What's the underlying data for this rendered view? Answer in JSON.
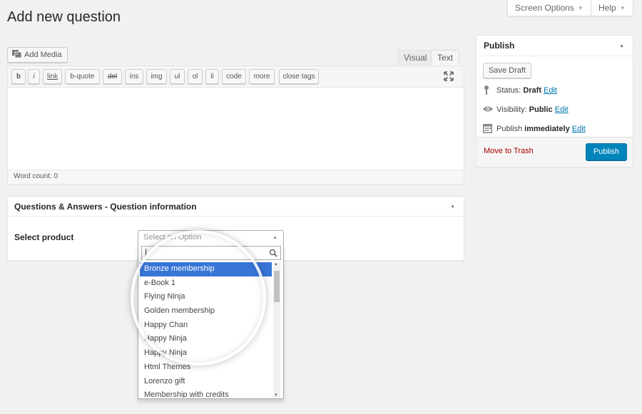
{
  "top_tabs": {
    "screen_options": "Screen Options",
    "help": "Help"
  },
  "page_title": "Add new question",
  "editor": {
    "add_media": "Add Media",
    "tabs": {
      "visual": "Visual",
      "text": "Text"
    },
    "toolbar": [
      "b",
      "i",
      "link",
      "b-quote",
      "del",
      "ins",
      "img",
      "ul",
      "ol",
      "li",
      "code",
      "more",
      "close tags"
    ],
    "word_count": "Word count: 0"
  },
  "metabox": {
    "title": "Questions & Answers - Question information",
    "field_label": "Select product",
    "select_placeholder": "Select an Option",
    "search_value": "",
    "options": [
      "Bronze membership",
      "e-Book 1",
      "Flying Ninja",
      "Golden membership",
      "Happy Chan",
      "Happy Ninja",
      "Happy Ninja",
      "Html Themes",
      "Lorenzo gift",
      "Membership with credits"
    ],
    "highlighted_index": 0
  },
  "publish": {
    "title": "Publish",
    "save_draft": "Save Draft",
    "status_label": "Status:",
    "status_value": "Draft",
    "visibility_label": "Visibility:",
    "visibility_value": "Public",
    "publish_label": "Publish",
    "publish_value": "immediately",
    "edit": "Edit",
    "move_to_trash": "Move to Trash",
    "publish_button": "Publish"
  },
  "colors": {
    "primary_button": "#0085ba",
    "link": "#0073aa",
    "trash": "#a00",
    "highlight": "#3875d7",
    "background": "#f1f1f1"
  },
  "icons": [
    "media-icon",
    "fullscreen-icon",
    "collapse-arrow-icon",
    "caret-up-icon",
    "search-icon",
    "pin-icon",
    "eye-icon",
    "calendar-icon"
  ]
}
